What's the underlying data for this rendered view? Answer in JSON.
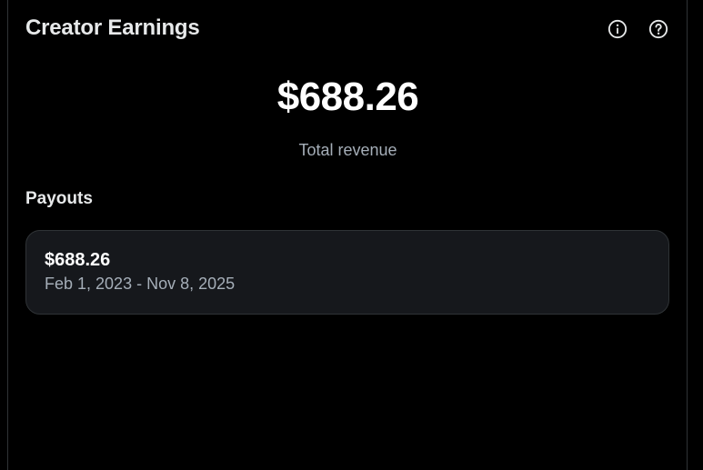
{
  "header": {
    "title": "Creator Earnings",
    "info_icon": "info-circle-icon",
    "help_icon": "question-circle-icon"
  },
  "summary": {
    "total_amount": "$688.26",
    "total_label": "Total revenue"
  },
  "payouts": {
    "section_title": "Payouts",
    "items": [
      {
        "amount": "$688.26",
        "date_range": "Feb 1, 2023 - Nov 8, 2025"
      }
    ]
  },
  "colors": {
    "background": "#000000",
    "primary_text": "#e7e9ea",
    "secondary_text": "#a5aeb8",
    "card_background": "#16181c",
    "border": "#2f3336"
  }
}
